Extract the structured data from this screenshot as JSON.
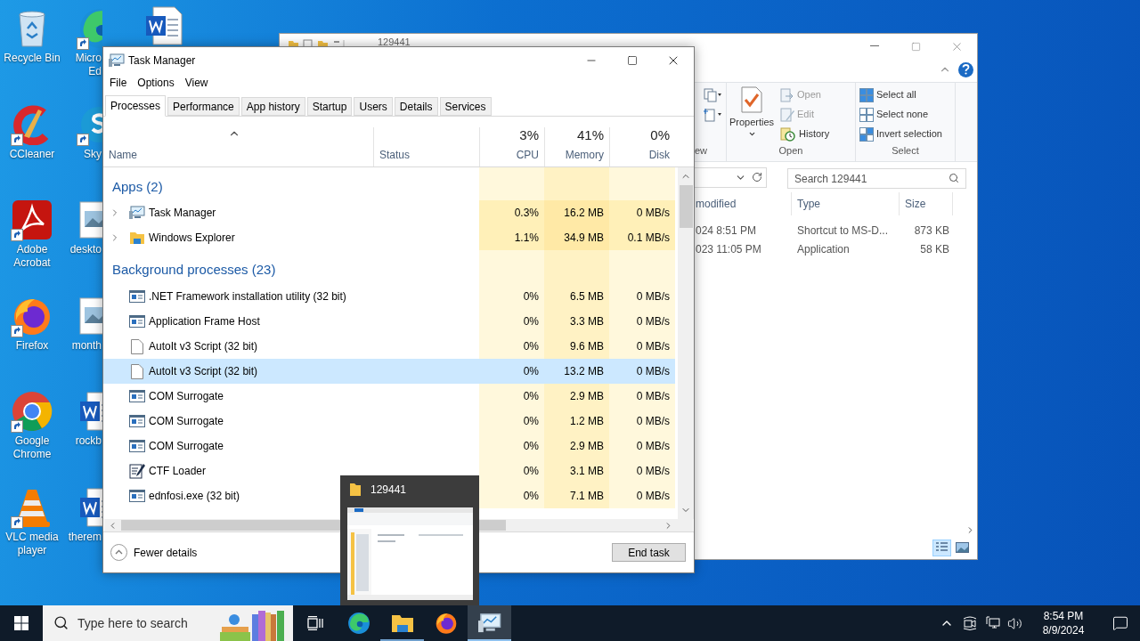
{
  "desktop": {
    "icons": [
      {
        "label": "Recycle Bin",
        "kind": "recycle",
        "shortcut": false
      },
      {
        "label": "CCleaner",
        "kind": "ccleaner",
        "shortcut": true
      },
      {
        "label": "Adobe Acrobat",
        "kind": "acrobat",
        "shortcut": true
      },
      {
        "label": "Firefox",
        "kind": "firefox",
        "shortcut": true
      },
      {
        "label": "Google Chrome",
        "kind": "chrome",
        "shortcut": true
      },
      {
        "label": "VLC media player",
        "kind": "vlc",
        "shortcut": true
      }
    ],
    "covered_icons": [
      {
        "lines": [
          "Micro",
          "Ed"
        ],
        "kind": "edge",
        "shortcut": true
      },
      {
        "lines": [
          "Sky"
        ],
        "kind": "skype",
        "shortcut": true
      },
      {
        "lines": [
          "deskto"
        ],
        "kind": "image",
        "shortcut": false
      },
      {
        "lines": [
          "month"
        ],
        "kind": "image",
        "shortcut": false
      },
      {
        "lines": [
          "rockb"
        ],
        "kind": "word",
        "shortcut": false
      },
      {
        "lines": [
          "therem"
        ],
        "kind": "word",
        "shortcut": false
      }
    ],
    "unlabeled_icons": [
      {
        "kind": "word"
      }
    ]
  },
  "explorer": {
    "title": "129441",
    "view_group_label": "ew",
    "properties": "Properties",
    "open_items": [
      {
        "label": "Open",
        "kind": "open",
        "disabled": true
      },
      {
        "label": "Edit",
        "kind": "edit",
        "disabled": true
      },
      {
        "label": "History",
        "kind": "history",
        "disabled": false
      }
    ],
    "open_group_label": "Open",
    "select_items": [
      {
        "label": "Select all",
        "kind": "all"
      },
      {
        "label": "Select none",
        "kind": "none"
      },
      {
        "label": "Invert selection",
        "kind": "invert"
      }
    ],
    "select_group_label": "Select",
    "search_placeholder": "Search 129441",
    "columns": [
      "modified",
      "Type",
      "Size"
    ],
    "rows": [
      {
        "modified": "024 8:51 PM",
        "type": "Shortcut to MS-D...",
        "size": "873 KB"
      },
      {
        "modified": "023 11:05 PM",
        "type": "Application",
        "size": "58 KB"
      }
    ],
    "view_buttons": [
      {
        "kind": "details",
        "selected": true
      },
      {
        "kind": "thumbnails",
        "selected": false
      }
    ]
  },
  "task_manager": {
    "title": "Task Manager",
    "menu": [
      "File",
      "Options",
      "View"
    ],
    "tabs": [
      {
        "label": "Processes",
        "selected": true
      },
      {
        "label": "Performance",
        "selected": false
      },
      {
        "label": "App history",
        "selected": false
      },
      {
        "label": "Startup",
        "selected": false
      },
      {
        "label": "Users",
        "selected": false
      },
      {
        "label": "Details",
        "selected": false
      },
      {
        "label": "Services",
        "selected": false
      }
    ],
    "columns": [
      {
        "label": "Name"
      },
      {
        "label": "Status"
      },
      {
        "label": "CPU",
        "total": "3%"
      },
      {
        "label": "Memory",
        "total": "41%"
      },
      {
        "label": "Disk",
        "total": "0%"
      }
    ],
    "groups": [
      {
        "title": "Apps (2)",
        "kind": "apps",
        "rows": [
          {
            "name": "Task Manager",
            "kind": "taskmgr",
            "expandable": true,
            "selected": false,
            "cpu": "0.3%",
            "memory": "16.2 MB",
            "disk": "0 MB/s"
          },
          {
            "name": "Windows Explorer",
            "kind": "explorer",
            "expandable": true,
            "selected": false,
            "cpu": "1.1%",
            "memory": "34.9 MB",
            "disk": "0.1 MB/s"
          }
        ]
      },
      {
        "title": "Background processes (23)",
        "kind": "background",
        "rows": [
          {
            "name": ".NET Framework installation utility (32 bit)",
            "kind": "frame",
            "expandable": false,
            "selected": false,
            "cpu": "0%",
            "memory": "6.5 MB",
            "disk": "0 MB/s"
          },
          {
            "name": "Application Frame Host",
            "kind": "frame",
            "expandable": false,
            "selected": false,
            "cpu": "0%",
            "memory": "3.3 MB",
            "disk": "0 MB/s"
          },
          {
            "name": "AutoIt v3 Script (32 bit)",
            "kind": "page",
            "expandable": false,
            "selected": false,
            "cpu": "0%",
            "memory": "9.6 MB",
            "disk": "0 MB/s"
          },
          {
            "name": "AutoIt v3 Script (32 bit)",
            "kind": "page",
            "expandable": false,
            "selected": true,
            "cpu": "0%",
            "memory": "13.2 MB",
            "disk": "0 MB/s"
          },
          {
            "name": "COM Surrogate",
            "kind": "frame",
            "expandable": false,
            "selected": false,
            "cpu": "0%",
            "memory": "2.9 MB",
            "disk": "0 MB/s"
          },
          {
            "name": "COM Surrogate",
            "kind": "frame",
            "expandable": false,
            "selected": false,
            "cpu": "0%",
            "memory": "1.2 MB",
            "disk": "0 MB/s"
          },
          {
            "name": "COM Surrogate",
            "kind": "frame",
            "expandable": false,
            "selected": false,
            "cpu": "0%",
            "memory": "2.9 MB",
            "disk": "0 MB/s"
          },
          {
            "name": "CTF Loader",
            "kind": "ctf",
            "expandable": false,
            "selected": false,
            "cpu": "0%",
            "memory": "3.1 MB",
            "disk": "0 MB/s"
          },
          {
            "name": "ednfosi.exe (32 bit)",
            "kind": "frame",
            "expandable": false,
            "selected": false,
            "cpu": "0%",
            "memory": "7.1 MB",
            "disk": "0 MB/s"
          }
        ]
      }
    ],
    "fewer_details": "Fewer details",
    "end_task": "End task"
  },
  "thumbnail": {
    "title": "129441"
  },
  "taskbar": {
    "search_placeholder": "Type here to search",
    "apps": [
      {
        "kind": "edge",
        "open": false,
        "active": false
      },
      {
        "kind": "explorer",
        "open": true,
        "active": false
      },
      {
        "kind": "firefox",
        "open": false,
        "active": false
      },
      {
        "kind": "taskmgr",
        "open": true,
        "active": true
      }
    ],
    "time": "8:54 PM",
    "date": "8/9/2024"
  }
}
